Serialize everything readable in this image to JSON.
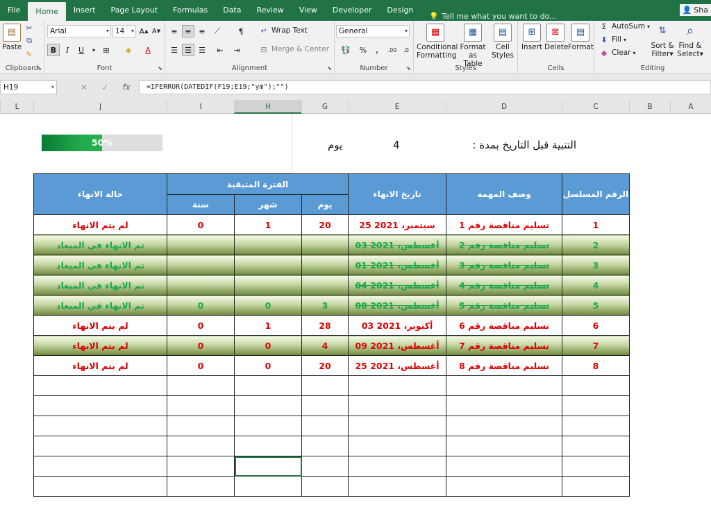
{
  "ribbon_tabs": [
    "File",
    "Home",
    "Insert",
    "Page Layout",
    "Formulas",
    "Data",
    "Review",
    "View",
    "Developer",
    "Design"
  ],
  "tell_me": "Tell me what you want to do...",
  "user": "Sha",
  "clipboard": {
    "paste": "Paste",
    "label": "Clipboard"
  },
  "font": {
    "name": "Arial",
    "size": "14",
    "label": "Font"
  },
  "alignment": {
    "wrap": "Wrap Text",
    "merge": "Merge & Center",
    "label": "Alignment"
  },
  "number": {
    "format": "General",
    "label": "Number"
  },
  "styles": {
    "conditional": "Conditional",
    "formatting": "Formatting",
    "format_as": "Format as",
    "table": "Table",
    "cell": "Cell",
    "cell_styles": "Styles",
    "label": "Styles"
  },
  "cells": {
    "insert": "Insert",
    "delete": "Delete",
    "format": "Format",
    "label": "Cells"
  },
  "editing": {
    "autosum": "AutoSum",
    "fill": "Fill",
    "clear": "Clear",
    "sort": "Sort &",
    "filter": "Filter",
    "find": "Find &",
    "select": "Select",
    "label": "Editing"
  },
  "name_box": "H19",
  "formula": "=IFERROR(DATEDIF(F19;E19;\"ym\");\"\")",
  "columns": [
    "L",
    "J",
    "I",
    "H",
    "G",
    "E",
    "D",
    "C",
    "B",
    "A"
  ],
  "progress": {
    "percent": 50,
    "label": "50%"
  },
  "alert": {
    "label": "التنبية قبل التاريخ بمدة :",
    "days": "4",
    "unit": "يوم"
  },
  "table": {
    "headers": {
      "serial": "الرقم المسلسل",
      "task": "وصف المهمة",
      "end_date": "تاريخ الانهاء",
      "remaining": "الفترة المتبقية",
      "day": "يوم",
      "month": "شهر",
      "year": "سنة",
      "status": "حالة الانهاء"
    },
    "rows": [
      {
        "serial": "1",
        "task": "تسليم مناقصة رقم 1",
        "date": "25 سبتمبر، 2021",
        "day": "20",
        "month": "1",
        "year": "0",
        "status": "لم يتم الانهاء",
        "style": "plain"
      },
      {
        "serial": "2",
        "task": "تسليم مناقصة رقم 2",
        "date": "03 أغسطس، 2021",
        "day": "",
        "month": "",
        "year": "",
        "status": "تم الانهاء في الميعاد",
        "style": "done"
      },
      {
        "serial": "3",
        "task": "تسليم مناقصة رقم 3",
        "date": "01 أغسطس، 2021",
        "day": "",
        "month": "",
        "year": "",
        "status": "تم الانهاء في الميعاد",
        "style": "done"
      },
      {
        "serial": "4",
        "task": "تسليم مناقصة رقم 4",
        "date": "04 أغسطس، 2021",
        "day": "",
        "month": "",
        "year": "",
        "status": "تم الانهاء في الميعاد",
        "style": "done"
      },
      {
        "serial": "5",
        "task": "تسليم مناقصة رقم 5",
        "date": "08 أغسطس، 2021",
        "day": "3",
        "month": "0",
        "year": "0",
        "status": "تم الانهاء في الميعاد",
        "style": "done"
      },
      {
        "serial": "6",
        "task": "تسليم مناقصة رقم 6",
        "date": "03 أكتوبر، 2021",
        "day": "28",
        "month": "1",
        "year": "0",
        "status": "لم يتم الانهاء",
        "style": "plain"
      },
      {
        "serial": "7",
        "task": "تسليم مناقصة رقم 7",
        "date": "09 أغسطس، 2021",
        "day": "4",
        "month": "0",
        "year": "0",
        "status": "لم يتم الانهاء",
        "style": "warn"
      },
      {
        "serial": "8",
        "task": "تسليم مناقصة رقم 8",
        "date": "25 أغسطس، 2021",
        "day": "20",
        "month": "0",
        "year": "0",
        "status": "لم يتم الانهاء",
        "style": "plain"
      }
    ],
    "empty_rows": 6
  },
  "colors": {
    "accent": "#217346",
    "header_blue": "#5b9bd5",
    "red": "#e00000",
    "green": "#1aa84a"
  }
}
